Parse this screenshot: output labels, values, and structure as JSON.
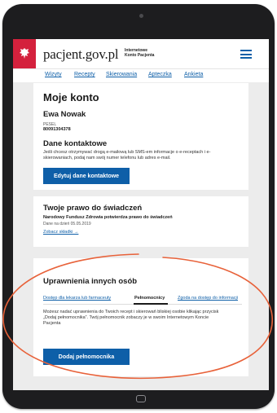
{
  "header": {
    "logo_text": "pacjent.gov.pl",
    "logo_sub_line1": "Internetowe",
    "logo_sub_line2": "Konto Pacjenta"
  },
  "nav": {
    "items": [
      "Wizyty",
      "Recepty",
      "Skierowania",
      "Apteczka",
      "Ankieta"
    ]
  },
  "account": {
    "title": "Moje konto",
    "name": "Ewa Nowak",
    "pesel_label": "PESEL",
    "pesel_value": "80091304378"
  },
  "contact": {
    "title": "Dane kontaktowe",
    "text": "Jeśli chcesz otrzymywać drogą e-mailową lub SMS-em informacje o e-receptach i e-skierowaniach, podaj nam swój numer telefonu lub adres e-mail.",
    "button_label": "Edytuj dane kontaktowe"
  },
  "benefits": {
    "title": "Twoje prawo do świadczeń",
    "subtitle": "Narodowy Fundusz Zdrowia potwierdza prawo do świadczeń",
    "date": "Dane na dzień 05.05.2019",
    "link": "Zobacz składki →"
  },
  "permissions": {
    "title": "Uprawnienia innych osób",
    "tabs": [
      "Dostęp dla lekarza lub farmaceuty",
      "Pełnomocnicy",
      "Zgoda na dostęp do informacji"
    ],
    "active_tab": "Pełnomocnicy",
    "text": "Możesz nadać uprawnienia do Twoich recept i skierowań bliskiej osobie klikając przycisk „Dodaj pełnomocnika”. Twój pełnomocnik zobaczy je w swoim Internetowym Koncie Pacjenta",
    "button_label": "Dodaj pełnomocnika"
  },
  "colors": {
    "brand_red": "#d4213d",
    "link_blue": "#0e5fa8",
    "annotation_orange": "#e8623a"
  },
  "icons": [
    "poland-eagle-emblem",
    "menu-icon",
    "home-button-icon"
  ]
}
